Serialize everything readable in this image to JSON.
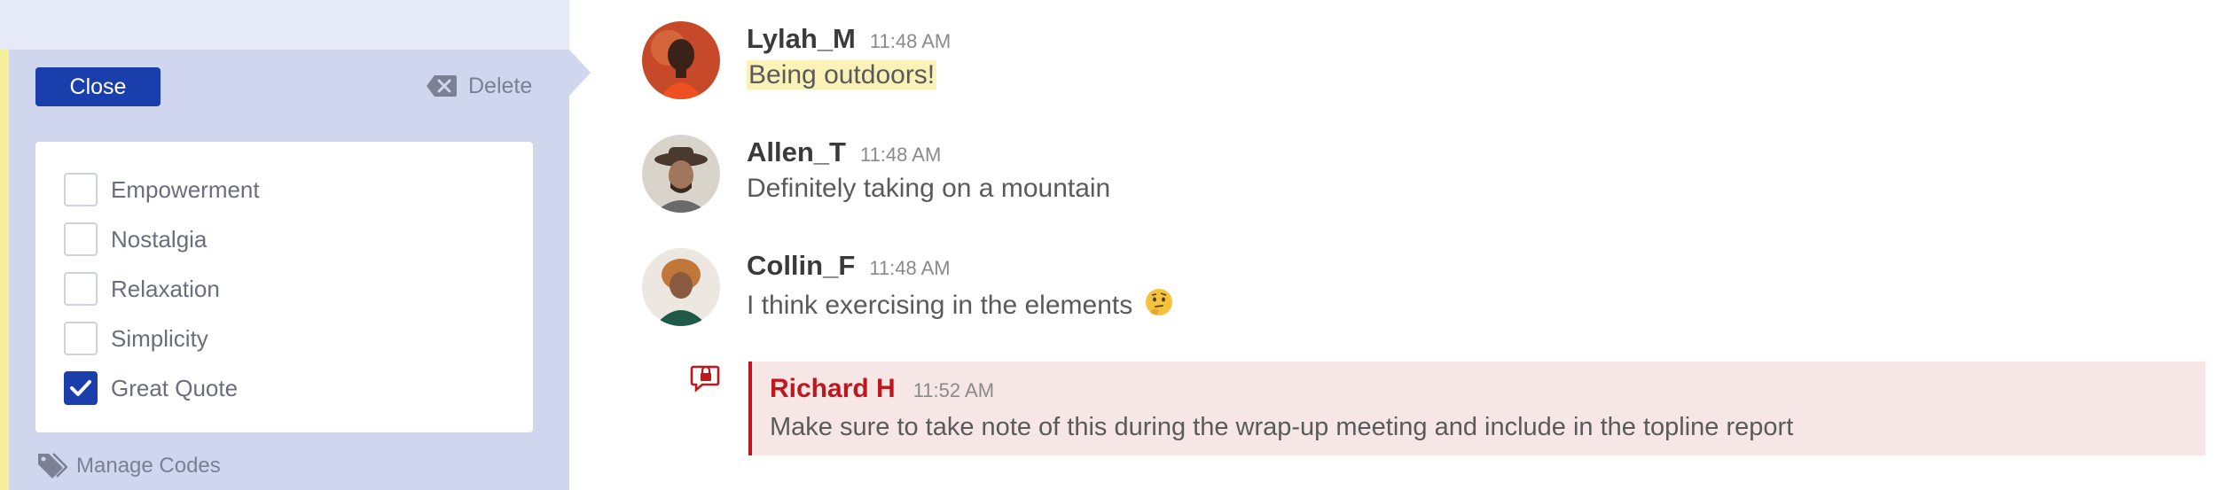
{
  "coding_panel": {
    "close_label": "Close",
    "delete_label": "Delete",
    "codes": [
      {
        "label": "Empowerment",
        "checked": false
      },
      {
        "label": "Nostalgia",
        "checked": false
      },
      {
        "label": "Relaxation",
        "checked": false
      },
      {
        "label": "Simplicity",
        "checked": false
      },
      {
        "label": "Great Quote",
        "checked": true
      }
    ],
    "manage_codes_label": "Manage Codes",
    "colors": {
      "panel_bg": "#cfd6ee",
      "accent": "#1a3fad",
      "highlight_edge": "#f6ef9a"
    }
  },
  "messages": [
    {
      "author": "Lylah_M",
      "time": "11:48 AM",
      "text": "Being outdoors!",
      "highlighted": true,
      "avatar": "avatar-lylah"
    },
    {
      "author": "Allen_T",
      "time": "11:48 AM",
      "text": "Definitely taking on a mountain",
      "highlighted": false,
      "avatar": "avatar-allen"
    },
    {
      "author": "Collin_F",
      "time": "11:48 AM",
      "text": "I think exercising in the elements",
      "emoji": "thinking-face-icon",
      "highlighted": false,
      "avatar": "avatar-collin"
    }
  ],
  "note": {
    "author": "Richard H",
    "time": "11:52 AM",
    "text": "Make sure to take note of this during the wrap-up meeting and include in the topline report",
    "icon": "private-note-icon",
    "colors": {
      "accent": "#c0171e",
      "bg": "#f6e6e6"
    }
  }
}
